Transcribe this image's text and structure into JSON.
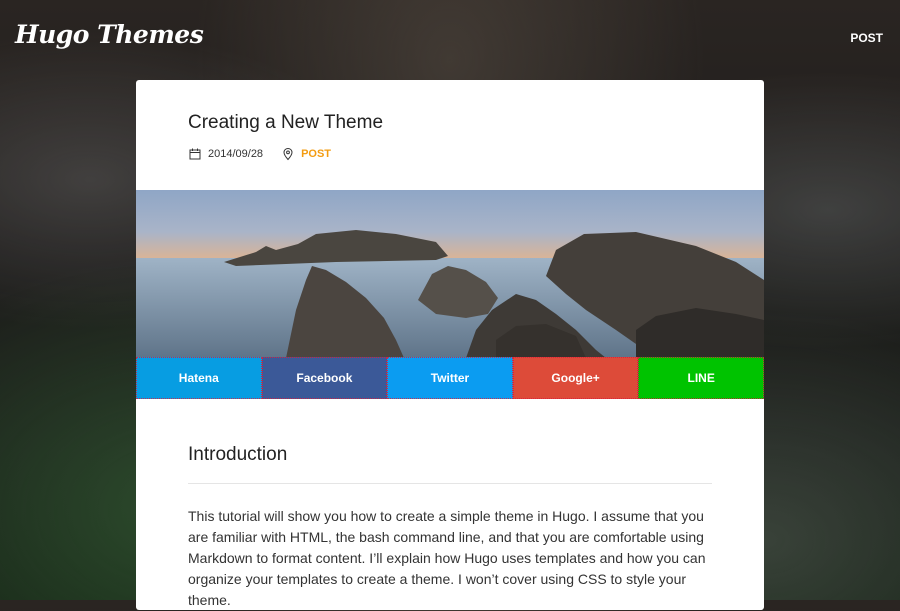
{
  "site": {
    "logo": "Hugo Themes",
    "nav_post": "POST"
  },
  "post": {
    "title": "Creating a New Theme",
    "date": "2014/09/28",
    "category": "POST",
    "icons": {
      "date": "calendar-icon",
      "category": "location-pin-icon"
    }
  },
  "share": [
    {
      "label": "Hatena",
      "color": "#079de2"
    },
    {
      "label": "Facebook",
      "color": "#3b5998"
    },
    {
      "label": "Twitter",
      "color": "#0b9cf1"
    },
    {
      "label": "Google+",
      "color": "#dd4b39"
    },
    {
      "label": "LINE",
      "color": "#00c300"
    }
  ],
  "content": {
    "heading": "Introduction",
    "paragraph": "This tutorial will show you how to create a simple theme in Hugo. I assume that you are familiar with HTML, the bash command line, and that you are comfortable using Markdown to format content. I’ll explain how Hugo uses templates and how you can organize your templates to create a theme. I won’t cover using CSS to style your theme."
  }
}
